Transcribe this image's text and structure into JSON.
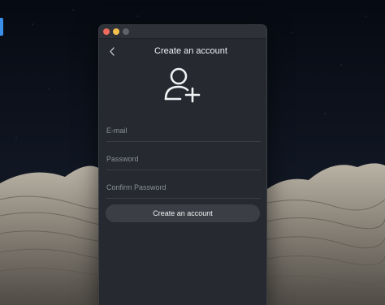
{
  "window": {
    "controls": {
      "close_icon": "traffic-light-close",
      "minimize_icon": "traffic-light-minimize",
      "maximize_icon": "traffic-light-maximize-disabled"
    }
  },
  "header": {
    "back_icon": "chevron-left-icon",
    "title": "Create an account"
  },
  "hero": {
    "icon": "add-user-icon"
  },
  "form": {
    "email_placeholder": "E-mail",
    "email_value": "",
    "password_placeholder": "Password",
    "password_value": "",
    "confirm_placeholder": "Confirm Password",
    "confirm_value": "",
    "submit_label": "Create an account"
  },
  "colors": {
    "window_bg": "#262a30",
    "button_bg": "#3b3f45",
    "text": "#f1f2f4",
    "placeholder": "#8a8f96"
  }
}
